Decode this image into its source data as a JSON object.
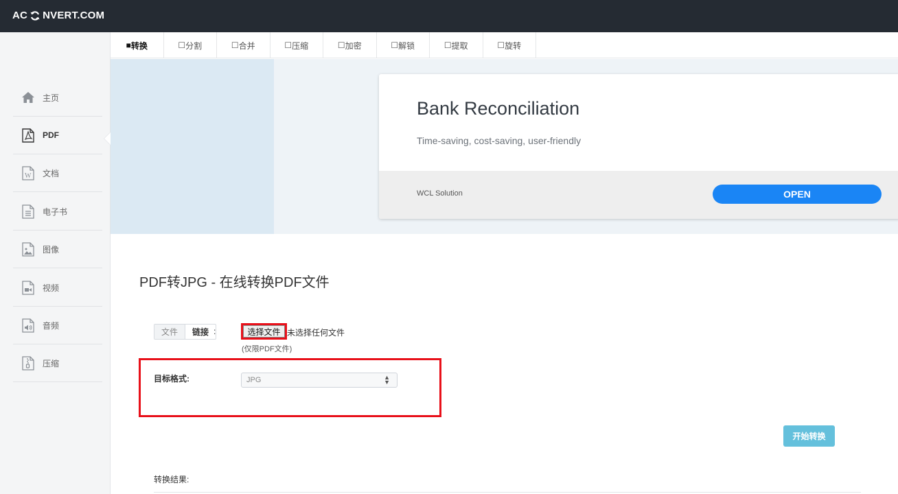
{
  "header": {
    "logo_prefix": "AC",
    "logo_suffix": "NVERT.COM",
    "logo_icon": "refresh-icon"
  },
  "tabs": [
    {
      "label": "转换",
      "checked": true
    },
    {
      "label": "分割",
      "checked": false
    },
    {
      "label": "合并",
      "checked": false
    },
    {
      "label": "压缩",
      "checked": false
    },
    {
      "label": "加密",
      "checked": false
    },
    {
      "label": "解锁",
      "checked": false
    },
    {
      "label": "提取",
      "checked": false
    },
    {
      "label": "旋转",
      "checked": false
    }
  ],
  "sidebar": {
    "items": [
      {
        "label": "主页",
        "icon": "home-icon"
      },
      {
        "label": "PDF",
        "icon": "pdf-file-icon",
        "active": true
      },
      {
        "label": "文档",
        "icon": "word-file-icon"
      },
      {
        "label": "电子书",
        "icon": "ebook-file-icon"
      },
      {
        "label": "图像",
        "icon": "image-file-icon"
      },
      {
        "label": "视频",
        "icon": "video-file-icon"
      },
      {
        "label": "音频",
        "icon": "audio-file-icon"
      },
      {
        "label": "压缩",
        "icon": "archive-file-icon"
      }
    ]
  },
  "ad": {
    "title": "Bank Reconciliation",
    "subtitle": "Time-saving, cost-saving, user-friendly",
    "brand": "WCL Solution",
    "button": "OPEN",
    "button_color": "#1a85f5"
  },
  "main": {
    "page_title": "PDF转JPG - 在线转换PDF文件",
    "source_tabs": {
      "file": "文件",
      "link": "链接",
      "colon": ":"
    },
    "choose_file_label": "选择文件",
    "no_file_text": "未选择任何文件",
    "hint": "(仅限PDF文件)",
    "target_format_label": "目标格式:",
    "target_format_value": "JPG",
    "start_button": "开始转换",
    "result_label": "转换结果:"
  },
  "colors": {
    "header_bg": "#252b33",
    "highlight_red": "#e8101a",
    "start_button": "#64c0dc"
  }
}
